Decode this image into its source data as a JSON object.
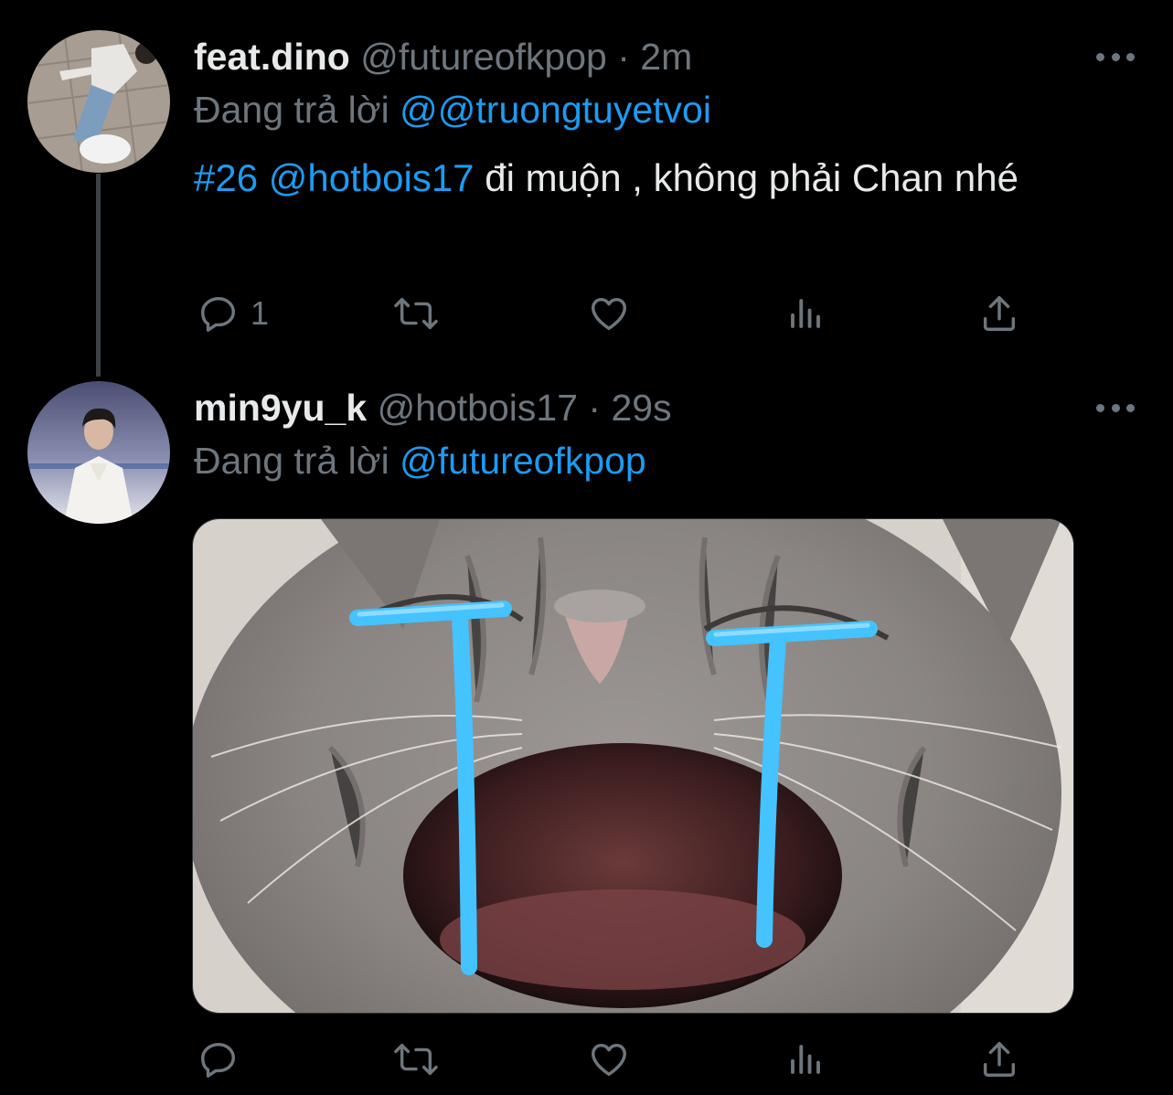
{
  "tweets": [
    {
      "display_name": "feat.dino",
      "handle": "@futureofkpop",
      "separator": "·",
      "time": "2m",
      "replying_prefix": "Đang trả lời",
      "replying_to": "@@truongtuyetvoi",
      "text_hashtag": "#26",
      "text_mention": "@hotbois17",
      "text_body": " đi muộn , không phải Chan nhé",
      "reply_count": "1"
    },
    {
      "display_name": "min9yu_k",
      "handle": "@hotbois17",
      "separator": "·",
      "time": "29s",
      "replying_prefix": "Đang trả lời",
      "replying_to": "@futureofkpop",
      "media_description_icon": "crying-cat-image"
    }
  ],
  "icons": {
    "more": "more-dots-icon",
    "reply": "reply-icon",
    "retweet": "retweet-icon",
    "like": "heart-icon",
    "analytics": "analytics-icon",
    "share": "share-icon"
  },
  "colors": {
    "background": "#000000",
    "text_primary": "#e7e9ea",
    "text_secondary": "#6e767d",
    "accent_link": "#1d9bf0",
    "thread_line": "#3e4144"
  }
}
